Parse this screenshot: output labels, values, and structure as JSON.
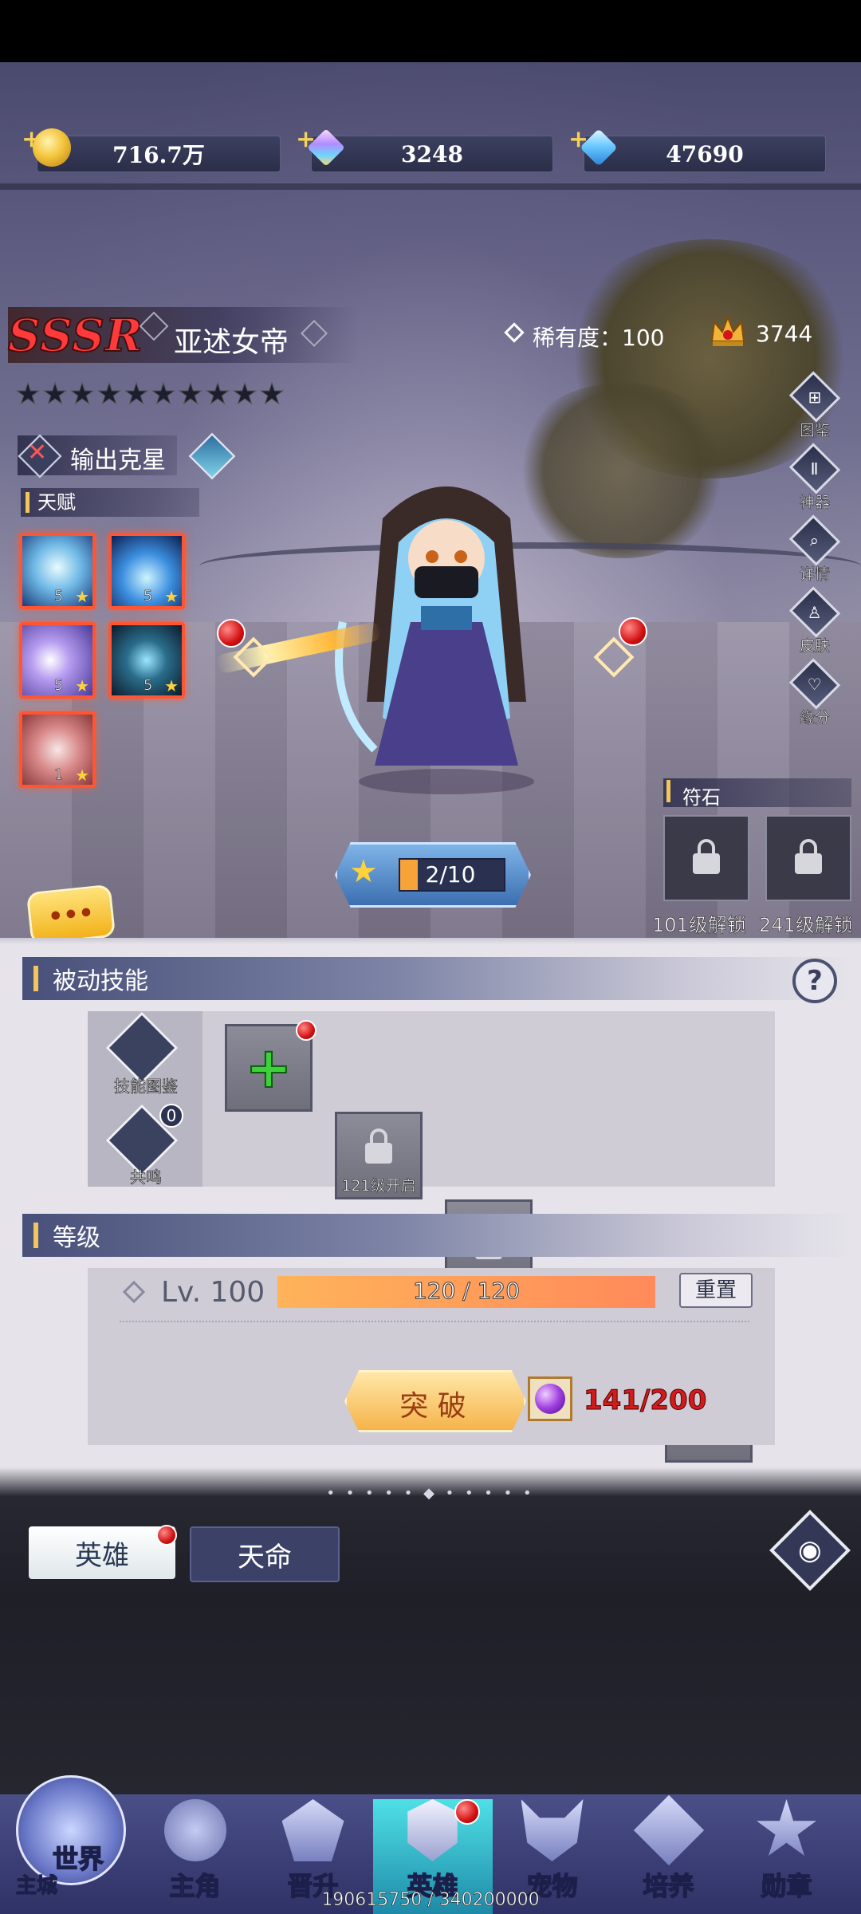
{
  "currency": [
    {
      "icon": "gold-coin-icon",
      "value": "716.7万"
    },
    {
      "icon": "crystal-icon",
      "value": "3248"
    },
    {
      "icon": "diamond-icon",
      "value": "47690"
    }
  ],
  "hero": {
    "rarity_badge": "SSSR",
    "name": "亚述女帝",
    "rarity_label": "稀有度：100",
    "power": "3744",
    "stars": 10,
    "role": "输出克星",
    "talent_title": "天赋",
    "talents": [
      {
        "icon": "ice-dragon-icon",
        "level": "5"
      },
      {
        "icon": "ice-crystal-icon",
        "level": "5"
      },
      {
        "icon": "purple-swirl-icon",
        "level": "5"
      },
      {
        "icon": "dark-burst-icon",
        "level": "5"
      },
      {
        "icon": "red-boot-icon",
        "level": "1"
      }
    ],
    "star_progress": "2/10"
  },
  "side_menu": [
    "图鉴",
    "神器",
    "详情",
    "皮肤",
    "缘分"
  ],
  "runes": {
    "title": "符石",
    "slots": [
      "101级解锁",
      "241级解锁"
    ]
  },
  "passive": {
    "title": "被动技能",
    "help": "?",
    "skill_codex": "技能图鉴",
    "resonance": "共鸣",
    "resonance_count": "0",
    "slot2_label": "121级开启"
  },
  "level": {
    "title": "等级",
    "lv": "Lv. 100",
    "exp": "120 / 120",
    "exp_fraction": 1.0,
    "reset": "重置",
    "breakthrough": "突 破",
    "material": "141/200"
  },
  "tabs": {
    "hero": "英雄",
    "destiny": "天命"
  },
  "nav": [
    {
      "label": "世界",
      "sub": "主城",
      "icon": "world-castle-icon"
    },
    {
      "label": "主角",
      "icon": "protagonist-icon"
    },
    {
      "label": "晋升",
      "icon": "promotion-icon"
    },
    {
      "label": "英雄",
      "icon": "hero-helmet-icon"
    },
    {
      "label": "宠物",
      "icon": "pet-icon"
    },
    {
      "label": "培养",
      "icon": "cultivate-icon"
    },
    {
      "label": "勋章",
      "icon": "medal-icon"
    }
  ],
  "footer_text": "190615750 / 340200000",
  "colors": {
    "accent_gold": "#f2c65a",
    "danger_red": "#d21010",
    "exp_orange": "#ff9a5a",
    "nav_bg": "#3a3d77"
  }
}
